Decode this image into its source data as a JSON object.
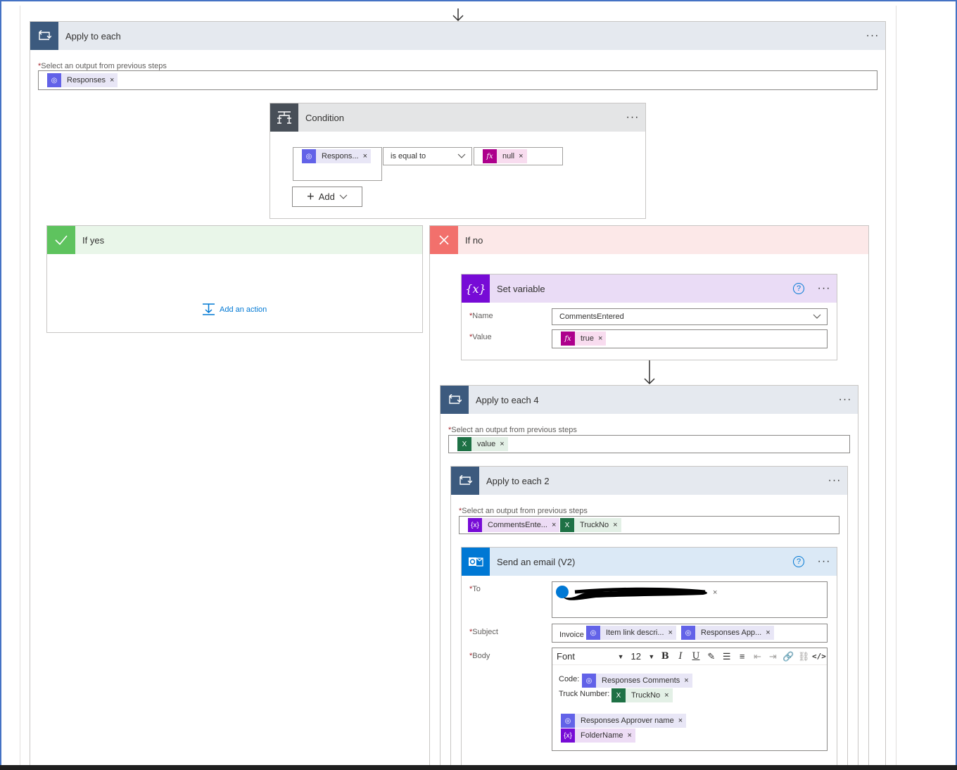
{
  "apply_to_each": {
    "title": "Apply to each",
    "more": "···",
    "field_label": "Select an output from previous steps",
    "token": "Responses",
    "remove": "×"
  },
  "condition": {
    "title": "Condition",
    "more": "···",
    "left_token": "Respons...",
    "operator": "is equal to",
    "right_token": "null",
    "add_label": "Add",
    "remove": "×"
  },
  "if_yes": {
    "title": "If yes",
    "add_action": "Add an action"
  },
  "if_no": {
    "title": "If no"
  },
  "set_variable": {
    "title": "Set variable",
    "help": "?",
    "more": "···",
    "name_label": "Name",
    "name_value": "CommentsEntered",
    "value_label": "Value",
    "value_token": "true",
    "remove": "×"
  },
  "apply_to_each_4": {
    "title": "Apply to each 4",
    "more": "···",
    "field_label": "Select an output from previous steps",
    "token": "value",
    "remove": "×"
  },
  "apply_to_each_2": {
    "title": "Apply to each 2",
    "more": "···",
    "field_label": "Select an output from previous steps",
    "token1": "CommentsEnte...",
    "token2": "TruckNo",
    "remove": "×"
  },
  "send_email": {
    "title": "Send an email (V2)",
    "help": "?",
    "more": "···",
    "to_label": "To",
    "subject_label": "Subject",
    "subject_prefix": "Invoice",
    "subject_token1": "Item link descri...",
    "subject_token2": "Responses App...",
    "body_label": "Body",
    "font_select": "Font",
    "font_size": "12",
    "body_code_label": "Code:",
    "body_code_token": "Responses Comments",
    "body_truck_label": "Truck Number:",
    "body_truck_token": "TruckNo",
    "body_approver_token": "Responses Approver name",
    "body_folder_token": "FolderName",
    "remove": "×"
  },
  "colors": {
    "loop_header": "#3c5a7e",
    "condition_header": "#484f58",
    "yes_accent": "#5ec35e",
    "no_accent": "#f2706c",
    "variable_accent": "#770bd6",
    "outlook_accent": "#0078d4",
    "forms_token": "#6262e8",
    "excel_token": "#1e7145",
    "expression_token": "#ad008c"
  }
}
